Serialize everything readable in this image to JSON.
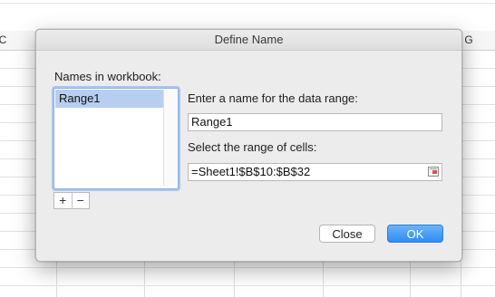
{
  "spreadsheet": {
    "column_headers": [
      "C",
      "G"
    ]
  },
  "dialog": {
    "title": "Define Name",
    "names_label": "Names in workbook:",
    "names": [
      "Range1"
    ],
    "add_label": "+",
    "remove_label": "−",
    "name_prompt": "Enter a name for the data range:",
    "name_value": "Range1",
    "range_prompt": "Select the range of cells:",
    "range_value": "=Sheet1!$B$10:$B$32",
    "close_label": "Close",
    "ok_label": "OK"
  },
  "colors": {
    "accent": "#2f8cf2",
    "selection": "#b6cef0"
  },
  "icons": [
    "range-picker-icon"
  ]
}
